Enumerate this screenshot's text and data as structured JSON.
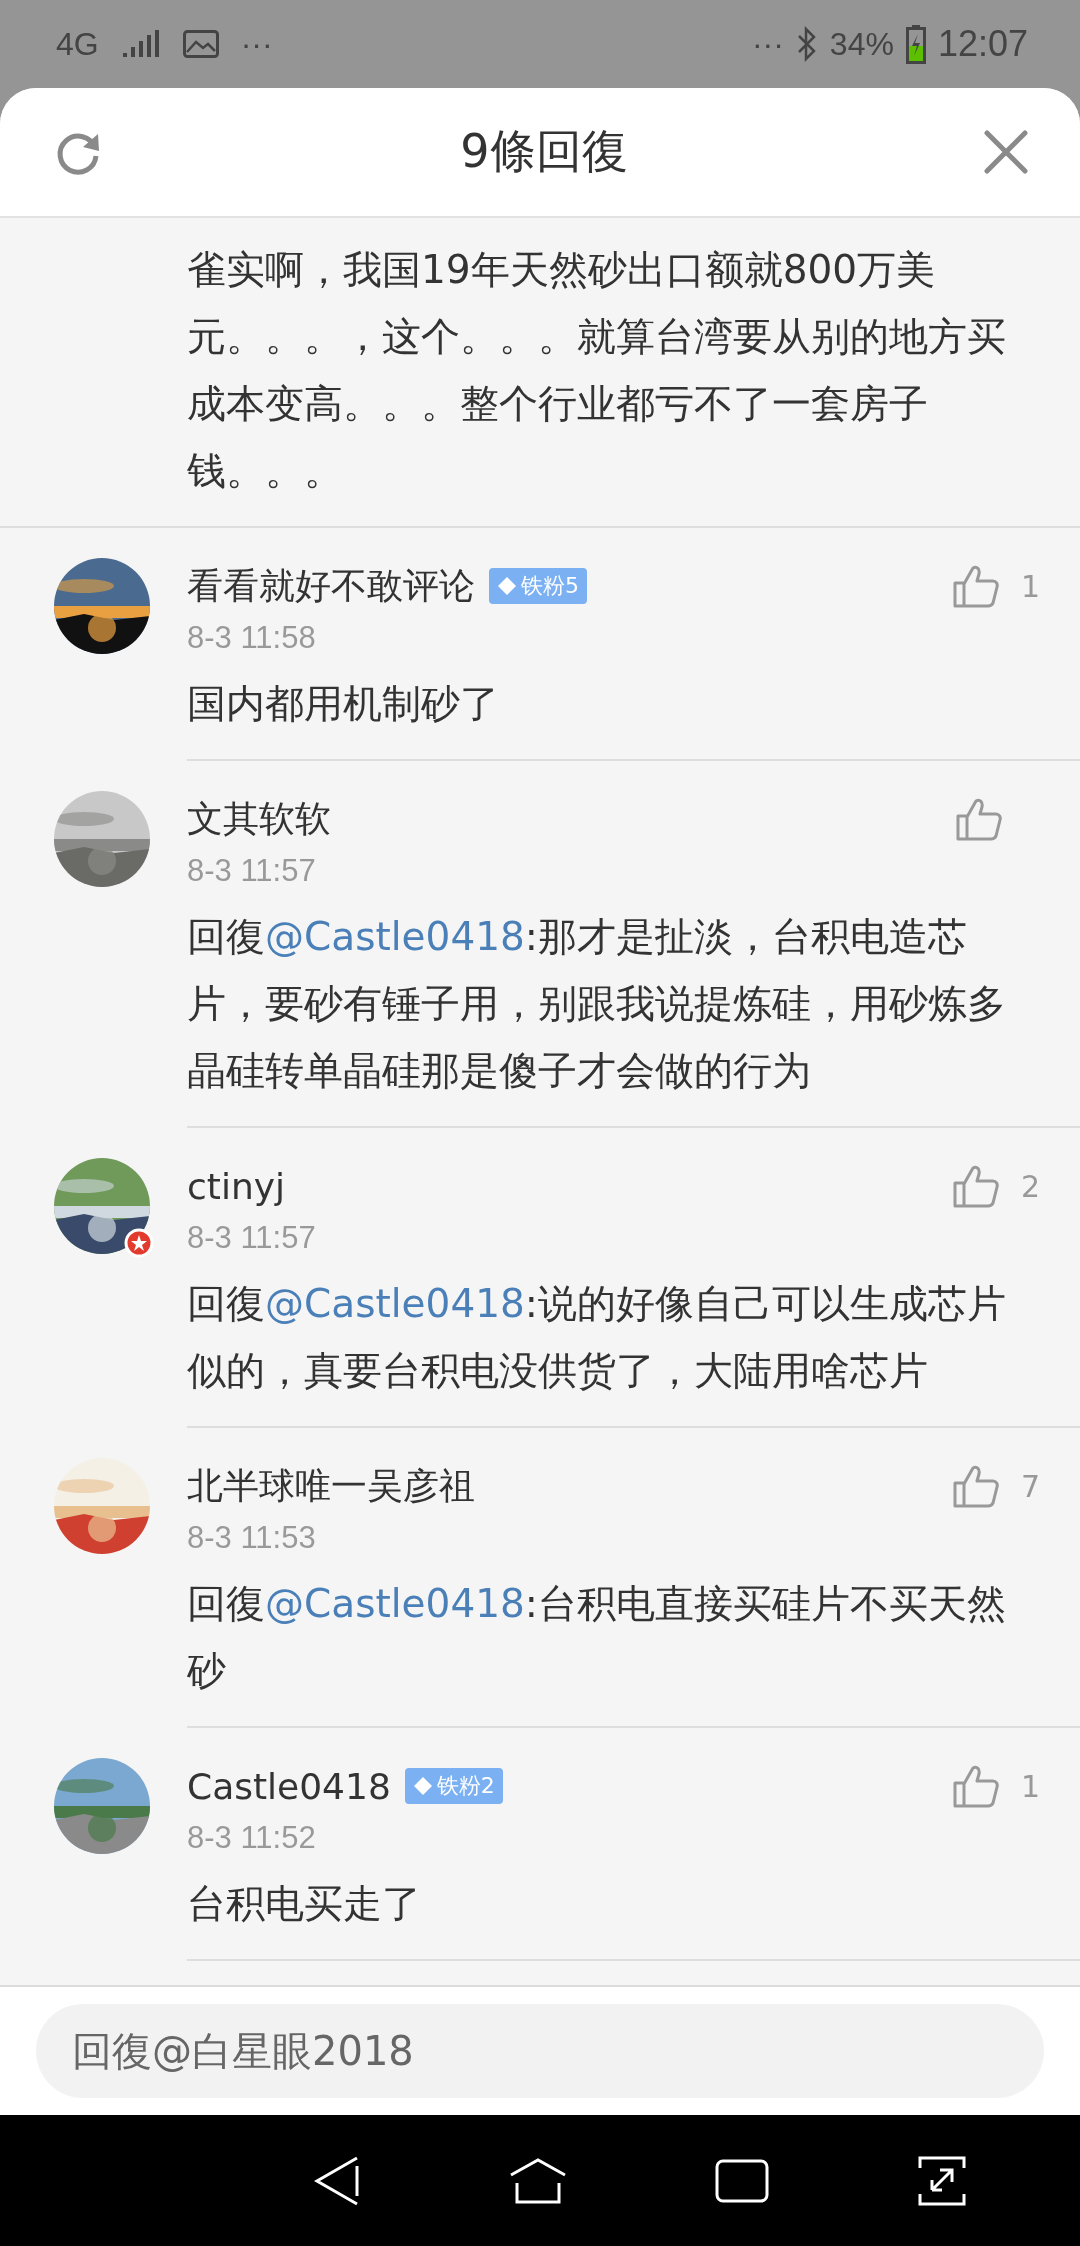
{
  "status_bar": {
    "network": "4G",
    "time": "12:07",
    "battery": "34%",
    "dots_left": "···",
    "dots_right": "···"
  },
  "header": {
    "title": "9條回復"
  },
  "partial_comment": {
    "text": "雀实啊，我国19年天然砂出口额就800万美元。。。，这个。。。就算台湾要从别的地方买成本变高。。。整个行业都亏不了一套房子钱。。。"
  },
  "comments": [
    {
      "name": "看看就好不敢评论",
      "badge": "铁粉5",
      "avatar_badge": false,
      "time": "8-3 11:58",
      "likes": "1",
      "text": "国内都用机制砂了"
    },
    {
      "name": "文其软软",
      "avatar_badge": false,
      "time": "8-3 11:57",
      "prefix": "回復",
      "mention": "@Castle0418",
      "text": ":那才是扯淡，台积电造芯片，要砂有锤子用，别跟我说提炼硅，用砂炼多晶硅转单晶硅那是傻子才会做的行为"
    },
    {
      "name": "ctinyj",
      "avatar_badge": true,
      "time": "8-3 11:57",
      "likes": "2",
      "prefix": "回復",
      "mention": "@Castle0418",
      "text": ":说的好像自己可以生成芯片似的，真要台积电没供货了，大陆用啥芯片"
    },
    {
      "name": "北半球唯一吴彦祖",
      "avatar_badge": false,
      "time": "8-3 11:53",
      "likes": "7",
      "prefix": "回復",
      "mention": "@Castle0418",
      "text": ":台积电直接买硅片不买天然砂"
    },
    {
      "name": "Castle0418",
      "badge": "铁粉2",
      "avatar_badge": false,
      "time": "8-3 11:52",
      "likes": "1",
      "text": "台积电买走了"
    }
  ],
  "reply_field": {
    "placeholder": "回復@白星眼2018"
  }
}
